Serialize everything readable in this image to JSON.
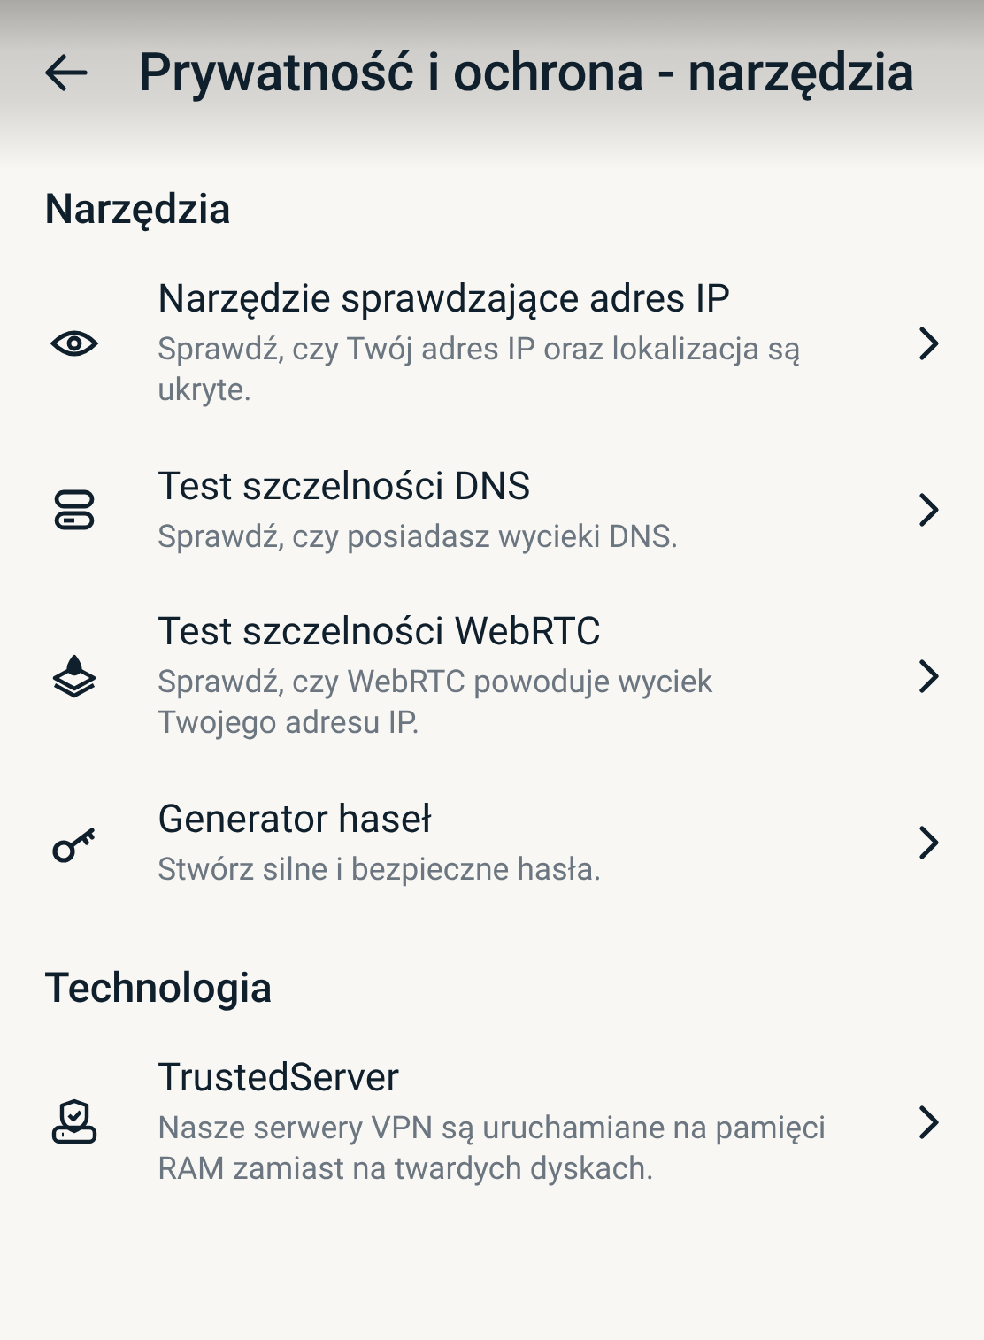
{
  "header": {
    "title": "Prywatność i ochrona - narzędzia"
  },
  "sections": [
    {
      "title": "Narzędzia",
      "items": [
        {
          "kind": "eye",
          "title": "Narzędzie sprawdzające adres IP",
          "description": "Sprawdź, czy Twój adres IP oraz lokalizacja są ukryte."
        },
        {
          "kind": "server",
          "title": "Test szczelności DNS",
          "description": "Sprawdź, czy posiadasz wycieki DNS."
        },
        {
          "kind": "layers",
          "title": "Test szczelności WebRTC",
          "description": "Sprawdź, czy WebRTC powoduje wyciek Twojego adresu IP."
        },
        {
          "kind": "key",
          "title": "Generator haseł",
          "description": "Stwórz silne i bezpieczne hasła."
        }
      ]
    },
    {
      "title": "Technologia",
      "items": [
        {
          "kind": "shield",
          "title": "TrustedServer",
          "description": "Nasze serwery VPN są uruchamiane na pamięci RAM zamiast na twardych dyskach."
        }
      ]
    }
  ]
}
